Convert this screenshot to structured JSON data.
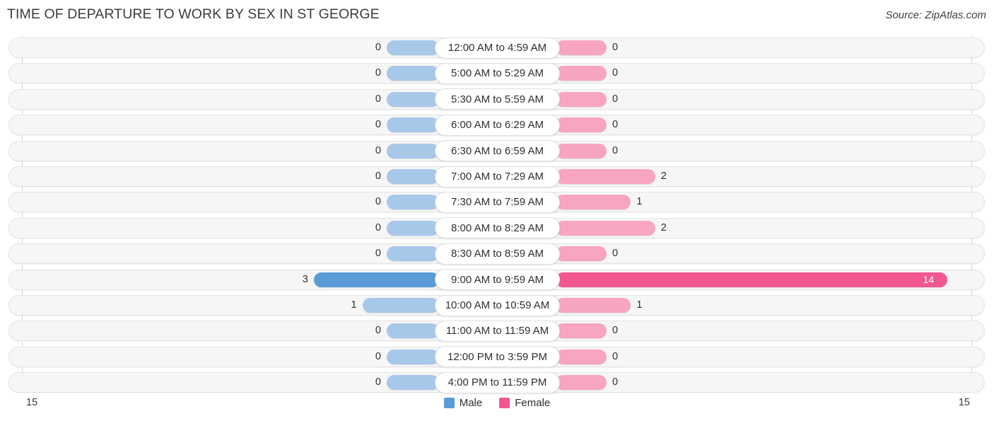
{
  "header": {
    "title": "TIME OF DEPARTURE TO WORK BY SEX IN ST GEORGE",
    "source": "Source: ZipAtlas.com"
  },
  "axis": {
    "left_tick": "15",
    "right_tick": "15"
  },
  "legend": {
    "items": [
      {
        "label": "Male",
        "color": "#5b9bd8"
      },
      {
        "label": "Female",
        "color": "#f2578f"
      }
    ]
  },
  "colors": {
    "male": "#5b9bd8",
    "male_muted": "#a8c8ea",
    "female": "#f2578f",
    "female_muted": "#f8a5c2",
    "track": "#f6f6f6",
    "track_border": "#e3e3e3"
  },
  "chart_data": {
    "type": "bar",
    "title": "TIME OF DEPARTURE TO WORK BY SEX IN ST GEORGE",
    "subtitle": "",
    "xlabel": "",
    "ylabel": "",
    "orientation": "horizontal",
    "style": "diverging-bidirectional-population-pyramid",
    "grid": false,
    "legend_position": "bottom-center",
    "axis_max_left": 15,
    "axis_max_right": 15,
    "xlim": [
      15,
      15
    ],
    "categories": [
      "12:00 AM to 4:59 AM",
      "5:00 AM to 5:29 AM",
      "5:30 AM to 5:59 AM",
      "6:00 AM to 6:29 AM",
      "6:30 AM to 6:59 AM",
      "7:00 AM to 7:29 AM",
      "7:30 AM to 7:59 AM",
      "8:00 AM to 8:29 AM",
      "8:30 AM to 8:59 AM",
      "9:00 AM to 9:59 AM",
      "10:00 AM to 10:59 AM",
      "11:00 AM to 11:59 AM",
      "12:00 PM to 3:59 PM",
      "4:00 PM to 11:59 PM"
    ],
    "series": [
      {
        "name": "Male",
        "color": "#5b9bd8",
        "values": [
          0,
          0,
          0,
          0,
          0,
          0,
          0,
          0,
          0,
          3,
          1,
          0,
          0,
          0
        ]
      },
      {
        "name": "Female",
        "color": "#f2578f",
        "values": [
          0,
          0,
          0,
          0,
          0,
          2,
          1,
          2,
          0,
          14,
          1,
          0,
          0,
          0
        ]
      }
    ],
    "highlighted_category": "9:00 AM to 9:59 AM"
  },
  "rows": [
    {
      "label": "12:00 AM to 4:59 AM",
      "male": "0",
      "female": "0",
      "male_val": 0,
      "female_val": 0,
      "highlight": false
    },
    {
      "label": "5:00 AM to 5:29 AM",
      "male": "0",
      "female": "0",
      "male_val": 0,
      "female_val": 0,
      "highlight": false
    },
    {
      "label": "5:30 AM to 5:59 AM",
      "male": "0",
      "female": "0",
      "male_val": 0,
      "female_val": 0,
      "highlight": false
    },
    {
      "label": "6:00 AM to 6:29 AM",
      "male": "0",
      "female": "0",
      "male_val": 0,
      "female_val": 0,
      "highlight": false
    },
    {
      "label": "6:30 AM to 6:59 AM",
      "male": "0",
      "female": "0",
      "male_val": 0,
      "female_val": 0,
      "highlight": false
    },
    {
      "label": "7:00 AM to 7:29 AM",
      "male": "0",
      "female": "2",
      "male_val": 0,
      "female_val": 2,
      "highlight": false
    },
    {
      "label": "7:30 AM to 7:59 AM",
      "male": "0",
      "female": "1",
      "male_val": 0,
      "female_val": 1,
      "highlight": false
    },
    {
      "label": "8:00 AM to 8:29 AM",
      "male": "0",
      "female": "2",
      "male_val": 0,
      "female_val": 2,
      "highlight": false
    },
    {
      "label": "8:30 AM to 8:59 AM",
      "male": "0",
      "female": "0",
      "male_val": 0,
      "female_val": 0,
      "highlight": false
    },
    {
      "label": "9:00 AM to 9:59 AM",
      "male": "3",
      "female": "14",
      "male_val": 3,
      "female_val": 14,
      "highlight": true
    },
    {
      "label": "10:00 AM to 10:59 AM",
      "male": "1",
      "female": "1",
      "male_val": 1,
      "female_val": 1,
      "highlight": false
    },
    {
      "label": "11:00 AM to 11:59 AM",
      "male": "0",
      "female": "0",
      "male_val": 0,
      "female_val": 0,
      "highlight": false
    },
    {
      "label": "12:00 PM to 3:59 PM",
      "male": "0",
      "female": "0",
      "male_val": 0,
      "female_val": 0,
      "highlight": false
    },
    {
      "label": "4:00 PM to 11:59 PM",
      "male": "0",
      "female": "0",
      "male_val": 0,
      "female_val": 0,
      "highlight": false
    }
  ]
}
